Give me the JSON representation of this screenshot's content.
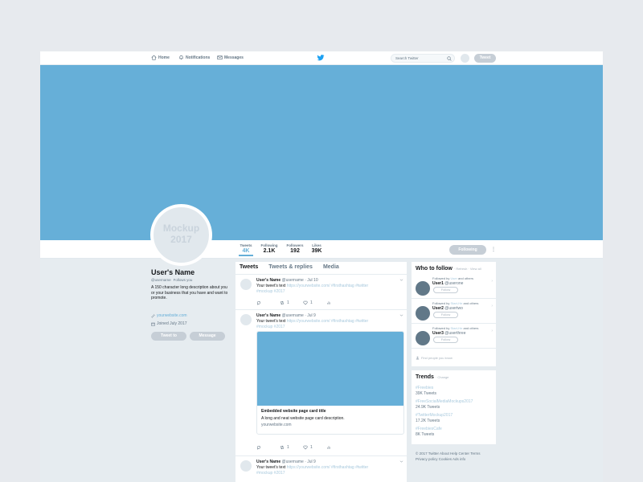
{
  "nav": {
    "home": "Home",
    "notifications": "Notifications",
    "messages": "Messages",
    "search_placeholder": "Search Twitter",
    "tweet_button": "Tweet"
  },
  "profile": {
    "avatar_line1": "Mockup",
    "avatar_line2": "2017",
    "name": "User's Name",
    "handle": "@username",
    "follows_you": "Follows you",
    "bio": "A 150 character long description about you or your business that you have and want to promote.",
    "website": "yourwebsite.com",
    "joined": "Joined July 2017",
    "tweet_to": "Tweet to",
    "message": "Message"
  },
  "stats": {
    "items": [
      {
        "label": "Tweets",
        "value": "4K"
      },
      {
        "label": "Following",
        "value": "2.1K"
      },
      {
        "label": "Followers",
        "value": "192"
      },
      {
        "label": "Likes",
        "value": "39K"
      }
    ],
    "following_button": "Following"
  },
  "timeline": {
    "tabs": [
      "Tweets",
      "Tweets & replies",
      "Media"
    ],
    "tweets": [
      {
        "name": "User's Name",
        "handle_date": "@username · Jul 10",
        "text": "Your tweet's text",
        "link": "https://yourwebsite.com/ #firsthashtag #twitter",
        "tag": "#mockup #2017",
        "retweets": "1",
        "likes": "1"
      },
      {
        "name": "User's Name",
        "handle_date": "@username · Jul 9",
        "text": "Your tweet's text",
        "link": "https://yourwebsite.com/ #firsthashtag #twitter",
        "tag": "#mockup #2017",
        "retweets": "1",
        "likes": "1",
        "card": {
          "title": "Embedded website page card title",
          "description": "A long and neat website page card description.",
          "url": "yourwebsite.com"
        }
      },
      {
        "name": "User's Name",
        "handle_date": "@username · Jul 9",
        "text": "Your tweet's text",
        "link": "https://yourwebsite.com/ #firsthashtag #twitter",
        "tag": "#mockup #2017"
      }
    ]
  },
  "who_to_follow": {
    "title": "Who to follow",
    "sub": "· Refresh · View all",
    "users": [
      {
        "followed_by": "Followed by",
        "by": "User",
        "rest": "and others",
        "name": "User1",
        "handle": "@userone",
        "button": "Follow"
      },
      {
        "followed_by": "Followed by",
        "by": "Start-He",
        "rest": "and others",
        "name": "User2",
        "handle": "@usertwo",
        "button": "Follow"
      },
      {
        "followed_by": "Followed by",
        "by": "Start-He",
        "rest": "and others",
        "name": "User3",
        "handle": "@userthree",
        "button": "Follow"
      }
    ],
    "find_people": "Find people you know"
  },
  "trends": {
    "title": "Trends",
    "change": "· Change",
    "items": [
      {
        "tag": "#Freebies",
        "count": "39K Tweets"
      },
      {
        "tag": "#FreeSocialMediaMockups2017",
        "count": "24.9K Tweets"
      },
      {
        "tag": "#TwitterMockup2017",
        "count": "17.2K Tweets"
      },
      {
        "tag": "#FreebiesCafe",
        "count": "8K Tweets"
      }
    ]
  },
  "footer": {
    "line1": "© 2017 Twitter About Help Center Terms",
    "line2": "Privacy policy Cookies Ads info"
  },
  "colors": {
    "accent": "#66afd8",
    "banner": "#66afd8",
    "button": "#c6ced6"
  }
}
